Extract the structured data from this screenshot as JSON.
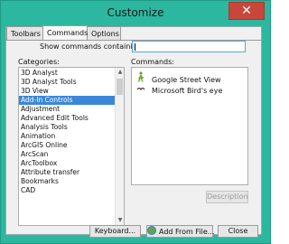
{
  "window": {
    "title": "Customize",
    "close_glyph": "✕"
  },
  "tabs": [
    "Toolbars",
    "Commands",
    "Options"
  ],
  "search": {
    "label": "Show commands containing:",
    "value": ""
  },
  "categories": {
    "label": "Categories:",
    "items": [
      "3D Analyst",
      "3D Analyst Tools",
      "3D View",
      "Add-In Controls",
      "Adjustment",
      "Advanced Edit Tools",
      "Analysis Tools",
      "Animation",
      "ArcGIS Online",
      "ArcScan",
      "ArcToolbox",
      "Attribute transfer",
      "Bookmarks",
      "CAD"
    ],
    "selected": "Add-In Controls"
  },
  "commands": {
    "label": "Commands:",
    "items": [
      {
        "name": "Google Street View",
        "icon": "pegman-icon"
      },
      {
        "name": "Microsoft Bird's eye",
        "icon": "bird-icon"
      }
    ]
  },
  "buttons": {
    "description": "Description",
    "keyboard": "Keyboard...",
    "add_from_file": "Add From File...",
    "close": "Close"
  },
  "colors": {
    "title_bar": "#2bb7a0",
    "selection": "#3a87d7",
    "close_button": "#c9463b"
  }
}
